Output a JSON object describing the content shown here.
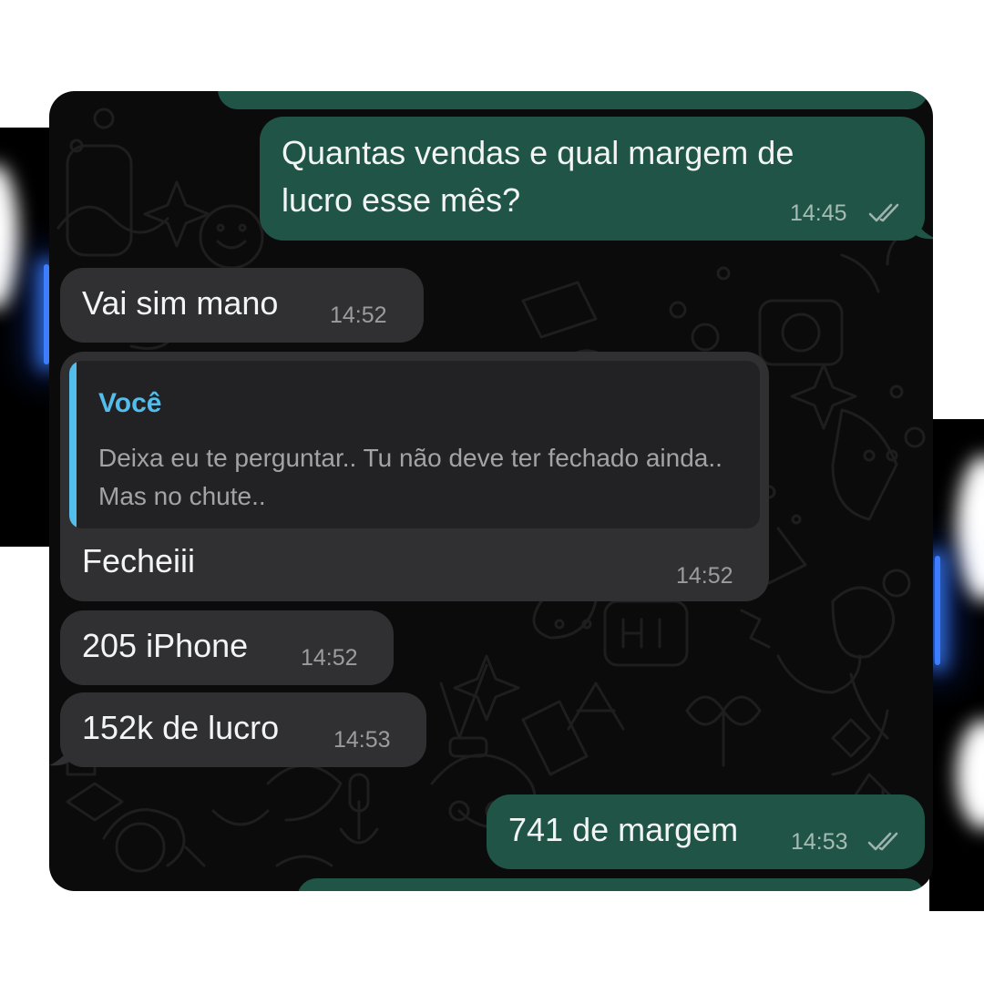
{
  "theme": {
    "outgoing_bubble": "#1f5446",
    "incoming_bubble": "#303033",
    "quote_accent": "#53bdeb",
    "chat_background": "#0b0b0b"
  },
  "messages": [
    {
      "direction": "outgoing",
      "text_line1": "Quantas vendas e qual margem de",
      "text_line2": "lucro esse mês?",
      "time": "14:45",
      "status": "read-double-check"
    },
    {
      "direction": "incoming",
      "text": "Vai sim mano",
      "time": "14:52"
    },
    {
      "direction": "incoming",
      "reply_to": {
        "author": "Você",
        "text": "Deixa eu te perguntar.. Tu não deve ter fechado ainda.. Mas no chute.."
      },
      "text": "Fecheiii",
      "time": "14:52"
    },
    {
      "direction": "incoming",
      "text": "205 iPhone",
      "time": "14:52"
    },
    {
      "direction": "incoming",
      "text": "152k de lucro",
      "time": "14:53"
    },
    {
      "direction": "outgoing",
      "text": "741 de margem",
      "time": "14:53",
      "status": "read-double-check"
    }
  ]
}
